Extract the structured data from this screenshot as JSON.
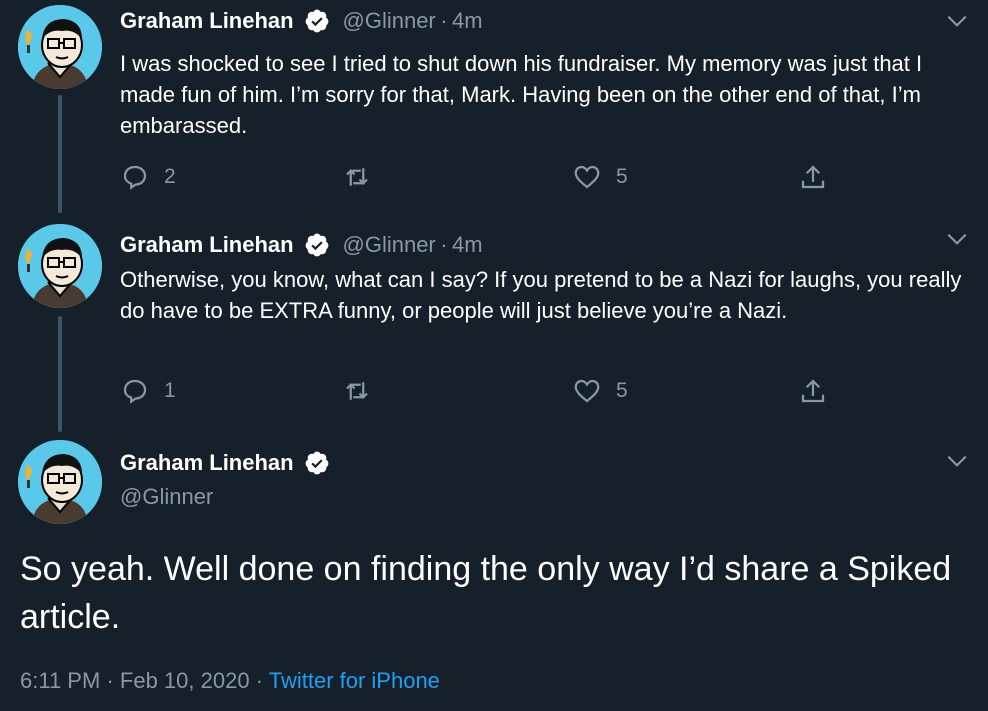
{
  "tweets": [
    {
      "name": "Graham Linehan",
      "handle": "@Glinner",
      "separator": "·",
      "time": "4m",
      "text": "I was shocked to see I tried to shut down his fundraiser. My memory was just that I made fun of him. I’m sorry for that, Mark. Having been on the other end of that, I’m embarassed.",
      "replies": "2",
      "retweets": "",
      "likes": "5"
    },
    {
      "name": "Graham Linehan",
      "handle": "@Glinner",
      "separator": "·",
      "time": "4m",
      "text": "Otherwise, you know, what can I say? If you pretend to be a Nazi for laughs, you really do have to be EXTRA funny, or people will just believe you’re a Nazi.",
      "replies": "1",
      "retweets": "",
      "likes": "5"
    }
  ],
  "main_tweet": {
    "name": "Graham Linehan",
    "handle": "@Glinner",
    "text": "So yeah. Well done on finding the only way I’d share a Spiked article.",
    "time": "6:11 PM",
    "date": "Feb 10, 2020",
    "separator": "·",
    "source": "Twitter for iPhone"
  },
  "colors": {
    "background": "#15202b",
    "text": "#ffffff",
    "secondary_text": "#8899a6",
    "link": "#1da1f2",
    "verified_badge": "#ffffff",
    "thread_line": "#3d5466"
  },
  "icons": [
    "verified-icon",
    "chevron-down-icon",
    "reply-icon",
    "retweet-icon",
    "like-icon",
    "share-icon",
    "avatar"
  ]
}
